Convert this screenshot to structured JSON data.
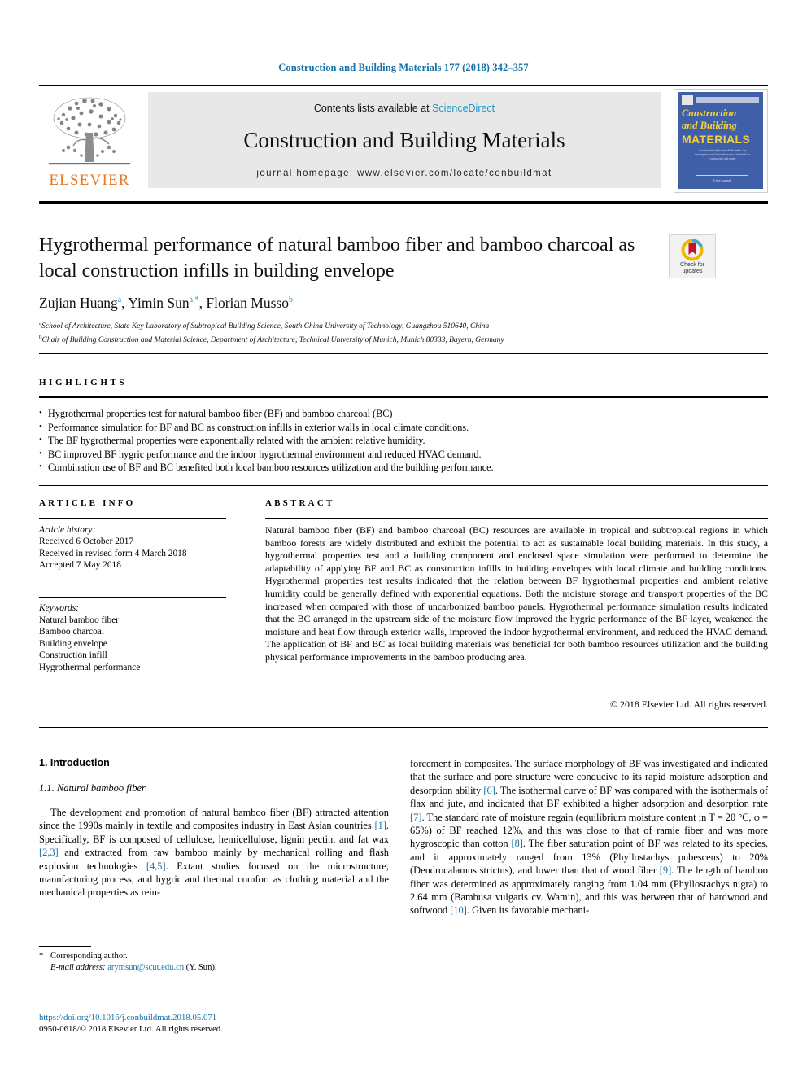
{
  "running_head": "Construction and Building Materials 177 (2018) 342–357",
  "masthead": {
    "publisher_name": "ELSEVIER",
    "contents_prefix": "Contents lists available at ",
    "contents_link": "ScienceDirect",
    "journal_title": "Construction and Building Materials",
    "homepage": "journal homepage: www.elsevier.com/locate/conbuildmat",
    "cover": {
      "line1": "Construction",
      "line2": "and Building",
      "line3": "MATERIALS",
      "blurb": "An international journal dedicated to the investigation and innovative use of materials in construction and repair",
      "footer": "A free journal"
    }
  },
  "article": {
    "title": "Hygrothermal performance of natural bamboo fiber and bamboo charcoal as local construction infills in building envelope",
    "crossmark": {
      "line1": "Check for",
      "line2": "updates"
    },
    "authors": [
      {
        "name": "Zujian Huang",
        "mark": "a",
        "sep": ", "
      },
      {
        "name": "Yimin Sun",
        "mark": "a,*",
        "sep": ", "
      },
      {
        "name": "Florian Musso",
        "mark": "b",
        "sep": ""
      }
    ],
    "affiliations": [
      {
        "mark": "a",
        "text": "School of Architecture, State Key Laboratory of Subtropical Building Science, South China University of Technology, Guangzhou 510640, China"
      },
      {
        "mark": "b",
        "text": "Chair of Building Construction and Material Science, Department of Architecture, Technical University of Munich, Munich 80333, Bayern, Germany"
      }
    ]
  },
  "highlights": {
    "heading": "HIGHLIGHTS",
    "items": [
      "Hygrothermal properties test for natural bamboo fiber (BF) and bamboo charcoal (BC)",
      "Performance simulation for BF and BC as construction infills in exterior walls in local climate conditions.",
      "The BF hygrothermal properties were exponentially related with the ambient relative humidity.",
      "BC improved BF hygric performance and the indoor hygrothermal environment and reduced HVAC demand.",
      "Combination use of BF and BC benefited both local bamboo resources utilization and the building performance."
    ]
  },
  "article_info": {
    "heading": "ARTICLE INFO",
    "history_label": "Article history:",
    "history": [
      "Received 6 October 2017",
      "Received in revised form 4 March 2018",
      "Accepted 7 May 2018"
    ],
    "keywords_label": "Keywords:",
    "keywords": [
      "Natural bamboo fiber",
      "Bamboo charcoal",
      "Building envelope",
      "Construction infill",
      "Hygrothermal performance"
    ]
  },
  "abstract": {
    "heading": "ABSTRACT",
    "text": "Natural bamboo fiber (BF) and bamboo charcoal (BC) resources are available in tropical and subtropical regions in which bamboo forests are widely distributed and exhibit the potential to act as sustainable local building materials. In this study, a hygrothermal properties test and a building component and enclosed space simulation were performed to determine the adaptability of applying BF and BC as construction infills in building envelopes with local climate and building conditions. Hygrothermal properties test results indicated that the relation between BF hygrothermal properties and ambient relative humidity could be generally defined with exponential equations. Both the moisture storage and transport properties of the BC increased when compared with those of uncarbonized bamboo panels. Hygrothermal performance simulation results indicated that the BC arranged in the upstream side of the moisture flow improved the hygric performance of the BF layer, weakened the moisture and heat flow through exterior walls, improved the indoor hygrothermal environment, and reduced the HVAC demand. The application of BF and BC as local building materials was beneficial for both bamboo resources utilization and the building physical performance improvements in the bamboo producing area.",
    "copyright": "© 2018 Elsevier Ltd. All rights reserved."
  },
  "body": {
    "section_number_title": "1. Introduction",
    "subsection_title": "1.1. Natural bamboo fiber",
    "left_paragraph_parts": [
      {
        "t": "The development and promotion of natural bamboo fiber (BF) attracted attention since the 1990s mainly in textile and composites industry in East Asian countries ",
        "ref": false
      },
      {
        "t": "[1]",
        "ref": true
      },
      {
        "t": ". Specifically, BF is composed of cellulose, hemicellulose, lignin pectin, and fat wax ",
        "ref": false
      },
      {
        "t": "[2,3]",
        "ref": true
      },
      {
        "t": " and extracted from raw bamboo mainly by mechanical rolling and flash explosion technologies ",
        "ref": false
      },
      {
        "t": "[4,5]",
        "ref": true
      },
      {
        "t": ". Extant studies focused on the microstructure, manufacturing process, and hygric and thermal comfort as clothing material and the mechanical properties as rein-",
        "ref": false
      }
    ],
    "right_paragraph_parts": [
      {
        "t": "forcement in composites. The surface morphology of BF was investigated and indicated that the surface and pore structure were conducive to its rapid moisture adsorption and desorption ability ",
        "ref": false
      },
      {
        "t": "[6]",
        "ref": true
      },
      {
        "t": ". The isothermal curve of BF was compared with the isothermals of flax and jute, and indicated that BF exhibited a higher adsorption and desorption rate ",
        "ref": false
      },
      {
        "t": "[7]",
        "ref": true
      },
      {
        "t": ". The standard rate of moisture regain (equilibrium moisture content in T = 20 °C, φ = 65%) of BF reached 12%, and this was close to that of ramie fiber and was more hygroscopic than cotton ",
        "ref": false
      },
      {
        "t": "[8]",
        "ref": true
      },
      {
        "t": ". The fiber saturation point of BF was related to its species, and it approximately ranged from 13% (Phyllostachys pubescens) to 20% (Dendrocalamus strictus), and lower than that of wood fiber ",
        "ref": false
      },
      {
        "t": "[9]",
        "ref": true
      },
      {
        "t": ". The length of bamboo fiber was determined as approximately ranging from 1.04 mm (Phyllostachys nigra) to 2.64 mm (Bambusa vulgaris cv. Wamin), and this was between that of hardwood and softwood ",
        "ref": false
      },
      {
        "t": "[10]",
        "ref": true
      },
      {
        "t": ". Given its favorable mechani-",
        "ref": false
      }
    ]
  },
  "footer": {
    "corresponding_marker": "*",
    "corresponding_text": "Corresponding author.",
    "email_label": "E-mail address:",
    "email": "arymsun@scut.edu.cn",
    "email_suffix": "(Y. Sun).",
    "doi": "https://doi.org/10.1016/j.conbuildmat.2018.05.071",
    "issn_line": "0950-0618/© 2018 Elsevier Ltd. All rights reserved."
  },
  "colors": {
    "link_blue": "#1672a8",
    "sciencedirect_blue": "#2196c4",
    "elsevier_orange": "#e87722",
    "cover_blue": "#3f5fa8",
    "cover_yellow": "#f4d03f",
    "masthead_gray": "#e8e8e8"
  }
}
